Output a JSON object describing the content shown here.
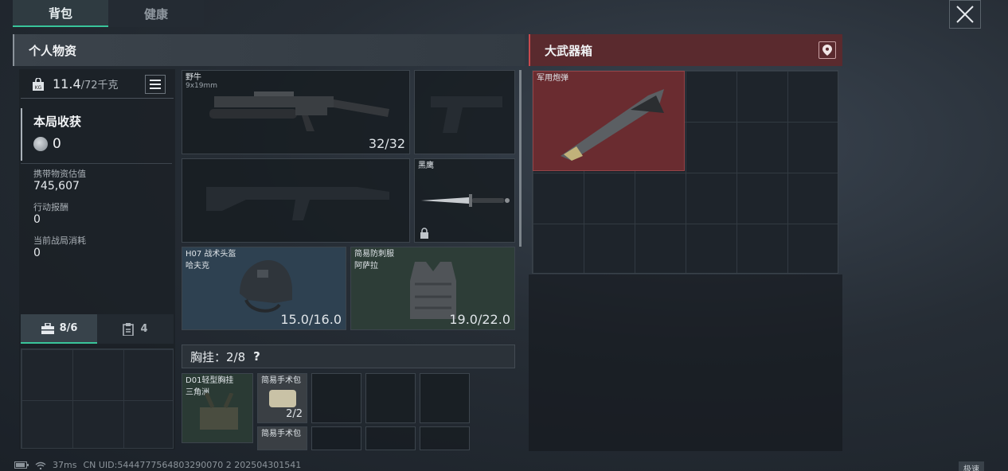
{
  "tabs": [
    {
      "label": "背包",
      "active": true
    },
    {
      "label": "健康",
      "active": false
    }
  ],
  "left_section": {
    "title": "个人物资"
  },
  "right_section": {
    "title": "大武器箱"
  },
  "weight": {
    "value": "11.4",
    "max": "/72千克"
  },
  "haul": {
    "title": "本局收获",
    "value": "0"
  },
  "stats": [
    {
      "label": "携带物资估值",
      "value": "745,607"
    },
    {
      "label": "行动报酬",
      "value": "0"
    },
    {
      "label": "当前战局消耗",
      "value": "0"
    }
  ],
  "sub_tabs": [
    {
      "label": "8/6",
      "icon": "toolbox-icon",
      "active": true
    },
    {
      "label": "4",
      "icon": "clipboard-icon",
      "active": false
    }
  ],
  "slots": {
    "primary": {
      "name": "野牛",
      "sub": "9x19mm",
      "count": "32/32"
    },
    "knife": {
      "name": "黑鹰"
    },
    "helmet": {
      "name": "H07 战术头盔",
      "sub": "哈夫克",
      "durability": "15.0/16.0"
    },
    "armor": {
      "name": "简易防刺服",
      "sub": "阿萨拉",
      "durability": "19.0/22.0"
    }
  },
  "chest_rig": {
    "label": "胸挂：2/8",
    "help": "?"
  },
  "rig_items": [
    {
      "name": "D01轻型胸挂",
      "sub": "三角洲"
    },
    {
      "name": "简易手术包",
      "count": "2/2"
    },
    {
      "name": "简易手术包"
    }
  ],
  "crate_items": [
    {
      "name": "军用炮弹"
    }
  ],
  "status_bar": {
    "ping": "37ms",
    "uid": "CN UID:5444777564803290070 2 202504301541",
    "speed": "极速"
  },
  "colors": {
    "accent": "#39c49a",
    "crate_red": "#5a2a2e"
  }
}
